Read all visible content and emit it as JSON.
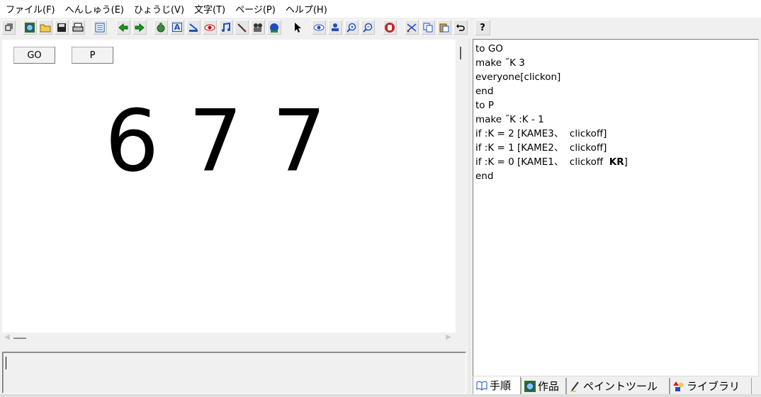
{
  "menu": [
    {
      "label": "ファイル(F)"
    },
    {
      "label": "へんしゅう(E)"
    },
    {
      "label": "ひょうじ(V)"
    },
    {
      "label": "文字(T)"
    },
    {
      "label": "ページ(P)"
    },
    {
      "label": "ヘルプ(H)"
    }
  ],
  "toolbar": {
    "text_tool_glyph": "A",
    "help_glyph": "?"
  },
  "page": {
    "buttons": [
      {
        "label": "GO"
      },
      {
        "label": "P"
      }
    ],
    "digits": [
      "6",
      "7",
      "7"
    ]
  },
  "procedures": {
    "lines": [
      {
        "text": "to GO"
      },
      {
        "text": "make ˝K 3"
      },
      {
        "text": "everyone[clickon]"
      },
      {
        "text": "end"
      },
      {
        "text": "to P"
      },
      {
        "text": "make ˝K :K - 1"
      },
      {
        "text": "if :K = 2 [KAME3、  clickoff]"
      },
      {
        "text": "if :K = 1 [KAME2、  clickoff]"
      },
      {
        "text": "if :K = 0 [KAME1、  clickoff  ",
        "bold": "KR",
        "tail": "]"
      },
      {
        "text": "end"
      }
    ]
  },
  "tabs": [
    {
      "label": "手順",
      "icon": "book-icon",
      "active": true
    },
    {
      "label": "作品",
      "icon": "globe-icon",
      "active": false
    },
    {
      "label": "ペイントツール",
      "icon": "brush-icon",
      "active": false
    },
    {
      "label": "ライブラリ",
      "icon": "shapes-icon",
      "active": false
    }
  ],
  "colors": {
    "accent_green": "#1a9a1a",
    "accent_blue": "#1f4fbf",
    "accent_red": "#d02020"
  }
}
